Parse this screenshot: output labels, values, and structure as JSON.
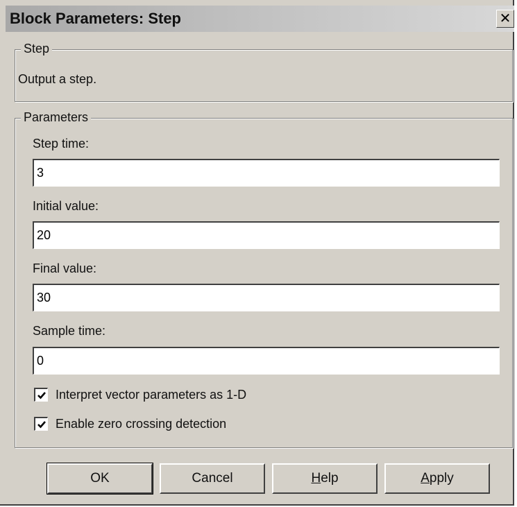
{
  "window": {
    "title": "Block Parameters: Step",
    "close_glyph": "✕"
  },
  "description_group": {
    "legend": "Step",
    "text": "Output a step."
  },
  "parameters_group": {
    "legend": "Parameters",
    "fields": [
      {
        "label": "Step time:",
        "value": "3"
      },
      {
        "label": "Initial value:",
        "value": "20"
      },
      {
        "label": "Final value:",
        "value": "30"
      },
      {
        "label": "Sample time:",
        "value": "0"
      }
    ],
    "checkboxes": [
      {
        "label": "Interpret vector parameters as 1-D",
        "checked": true
      },
      {
        "label": "Enable zero crossing detection",
        "checked": true
      }
    ]
  },
  "buttons": {
    "ok": "OK",
    "cancel": "Cancel",
    "help_mnemonic": "H",
    "help_rest": "elp",
    "apply_mnemonic": "A",
    "apply_rest": "pply"
  },
  "icons": {
    "close": "close-icon",
    "checkmark": "checkmark-icon"
  }
}
